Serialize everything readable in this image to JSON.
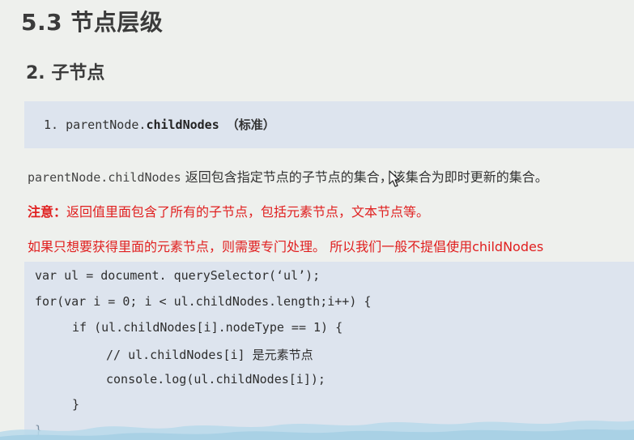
{
  "header": {
    "title": "5.3 节点层级",
    "subtitle": "2. 子节点"
  },
  "api": {
    "number": "1.",
    "object": "parentNode.",
    "property": "childNodes",
    "note": "（标准）"
  },
  "description": {
    "code": "parentNode.childNodes",
    "text": " 返回包含指定节点的子节点的集合，该集合为即时更新的集合。"
  },
  "notice": {
    "label": "注意：",
    "text": "返回值里面包含了所有的子节点，包括元素节点，文本节点等。"
  },
  "tip": "如果只想要获得里面的元素节点，则需要专门处理。 所以我们一般不提倡使用childNodes",
  "code": {
    "lines": [
      "var ul = document. querySelector(‘ul’);",
      "for(var i = 0; i < ul.childNodes.length;i++) {",
      "if (ul.childNodes[i].nodeType == 1) {",
      "// ul.childNodes[i] 是元素节点",
      "console.log(ul.childNodes[i]);",
      "}",
      "}"
    ]
  },
  "colors": {
    "background": "#eef0ed",
    "code_background": "#dde4ee",
    "warning": "#e02020",
    "heading": "#3b3b3b",
    "wave": "#b9d9ea"
  },
  "icons": {
    "cursor": "mouse-pointer-icon"
  }
}
